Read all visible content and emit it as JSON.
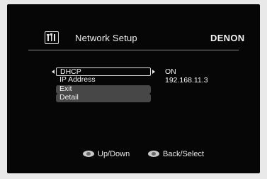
{
  "header": {
    "title": "Network Setup",
    "brand": "DENON",
    "icon": "network-setup-icon"
  },
  "menu": {
    "items": [
      {
        "label": "DHCP",
        "value": "ON",
        "selected": true
      },
      {
        "label": "IP Address",
        "value": "192.168.11.3"
      }
    ],
    "buttons": [
      {
        "label": "Exit"
      },
      {
        "label": "Detail"
      }
    ]
  },
  "footer": {
    "updown_label": "Up/Down",
    "backselect_label": "Back/Select",
    "icon": "remote-pad-icon"
  },
  "colors": {
    "screen_background": "#060606",
    "text": "#f4f4f4",
    "button_fill": "#474747",
    "selection_border": "#dcdcdc"
  }
}
